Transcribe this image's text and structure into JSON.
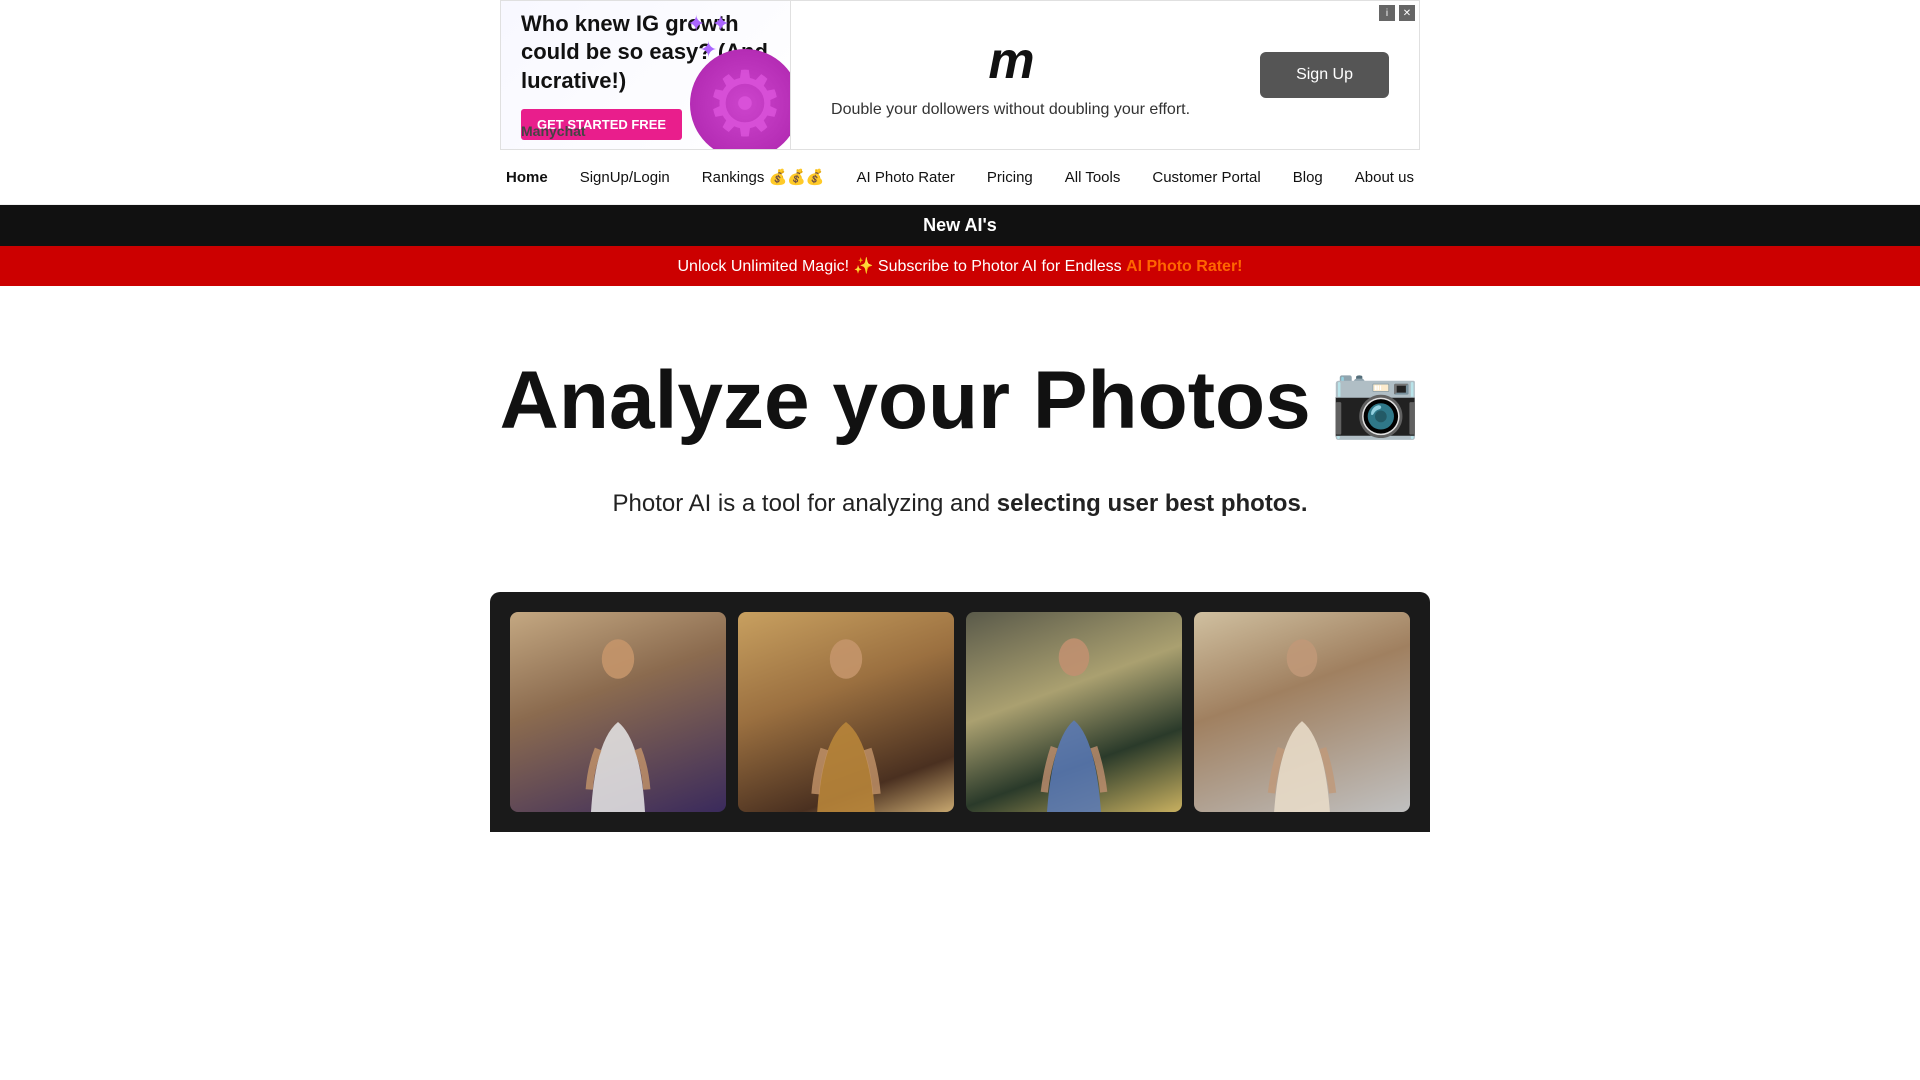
{
  "ad": {
    "headline": "Who knew IG growth could be so easy? (And lucrative!)",
    "cta_label": "GET STARTED FREE",
    "brand": "Manychat",
    "logo": "m",
    "tagline": "Double your dollowers without doubling your effort.",
    "signup_label": "Sign Up",
    "close_label": "✕",
    "info_label": "i"
  },
  "nav": {
    "links": [
      {
        "label": "Home",
        "active": true
      },
      {
        "label": "SignUp/Login",
        "active": false
      },
      {
        "label": "Rankings 💰💰💰",
        "active": false
      },
      {
        "label": "AI Photo Rater",
        "active": false
      },
      {
        "label": "Pricing",
        "active": false
      },
      {
        "label": "All Tools",
        "active": false
      },
      {
        "label": "Customer Portal",
        "active": false
      },
      {
        "label": "Blog",
        "active": false
      },
      {
        "label": "About us",
        "active": false
      }
    ]
  },
  "black_banner": {
    "text": "New AI's"
  },
  "red_banner": {
    "normal_text": "Unlock Unlimited Magic! ✨ Subscribe to Photor AI for Endless ",
    "highlight_text": "AI Photo Rater!"
  },
  "hero": {
    "title": "Analyze your Photos",
    "camera_emoji": "📷",
    "subtitle_normal": "Photor AI is a tool for analyzing and ",
    "subtitle_bold": "selecting user best photos."
  },
  "photos": [
    {
      "id": "photo-1",
      "alt": "Woman in white shirt at sunset"
    },
    {
      "id": "photo-2",
      "alt": "Woman in brown coat"
    },
    {
      "id": "photo-3",
      "alt": "Woman in denim jacket near lamppost"
    },
    {
      "id": "photo-4",
      "alt": "Woman in cream sweater"
    }
  ]
}
